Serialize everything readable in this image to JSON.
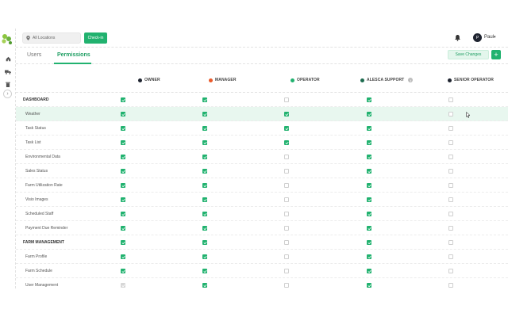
{
  "topbar": {
    "location_label": "All Locations",
    "checkin_label": "Check-in",
    "user_initial": "P",
    "user_name": "Paul"
  },
  "tabs": [
    {
      "label": "Users",
      "active": false
    },
    {
      "label": "Permissions",
      "active": true
    }
  ],
  "actions": {
    "save_label": "Save Changes",
    "add_label": "+"
  },
  "roles": [
    {
      "name": "OWNER",
      "color": "#1f2430"
    },
    {
      "name": "MANAGER",
      "color": "#ea5a2b"
    },
    {
      "name": "OPERATOR",
      "color": "#21b26f"
    },
    {
      "name": "ALESCA SUPPORT",
      "color": "#1d6b4f",
      "info": true
    },
    {
      "name": "SENIOR OPERATOR",
      "color": "#1f2430"
    }
  ],
  "rows": [
    {
      "label": "DASHBOARD",
      "section": true,
      "perms": [
        "on",
        "on",
        "off",
        "on",
        "off"
      ]
    },
    {
      "label": "Weather",
      "highlight": true,
      "perms": [
        "on",
        "on",
        "on",
        "on",
        "off"
      ]
    },
    {
      "label": "Task Status",
      "perms": [
        "on",
        "on",
        "on",
        "on",
        "off"
      ]
    },
    {
      "label": "Task List",
      "perms": [
        "on",
        "on",
        "on",
        "on",
        "off"
      ]
    },
    {
      "label": "Environmental Data",
      "perms": [
        "on",
        "on",
        "off",
        "on",
        "off"
      ]
    },
    {
      "label": "Sales Status",
      "perms": [
        "on",
        "on",
        "off",
        "on",
        "off"
      ]
    },
    {
      "label": "Farm Utilization Rate",
      "perms": [
        "on",
        "on",
        "off",
        "on",
        "off"
      ]
    },
    {
      "label": "Visio Images",
      "perms": [
        "on",
        "on",
        "off",
        "on",
        "off"
      ]
    },
    {
      "label": "Scheduled Staff",
      "perms": [
        "on",
        "on",
        "off",
        "on",
        "off"
      ]
    },
    {
      "label": "Payment Due Reminder",
      "perms": [
        "on",
        "on",
        "off",
        "on",
        "off"
      ]
    },
    {
      "label": "FARM MANAGEMENT",
      "section": true,
      "perms": [
        "on",
        "on",
        "off",
        "on",
        "off"
      ]
    },
    {
      "label": "Farm Profile",
      "perms": [
        "on",
        "on",
        "off",
        "on",
        "off"
      ]
    },
    {
      "label": "Farm Schedule",
      "perms": [
        "on",
        "on",
        "off",
        "on",
        "off"
      ]
    },
    {
      "label": "User Management",
      "perms": [
        "disabled-on",
        "on",
        "off",
        "on",
        "off"
      ]
    }
  ]
}
